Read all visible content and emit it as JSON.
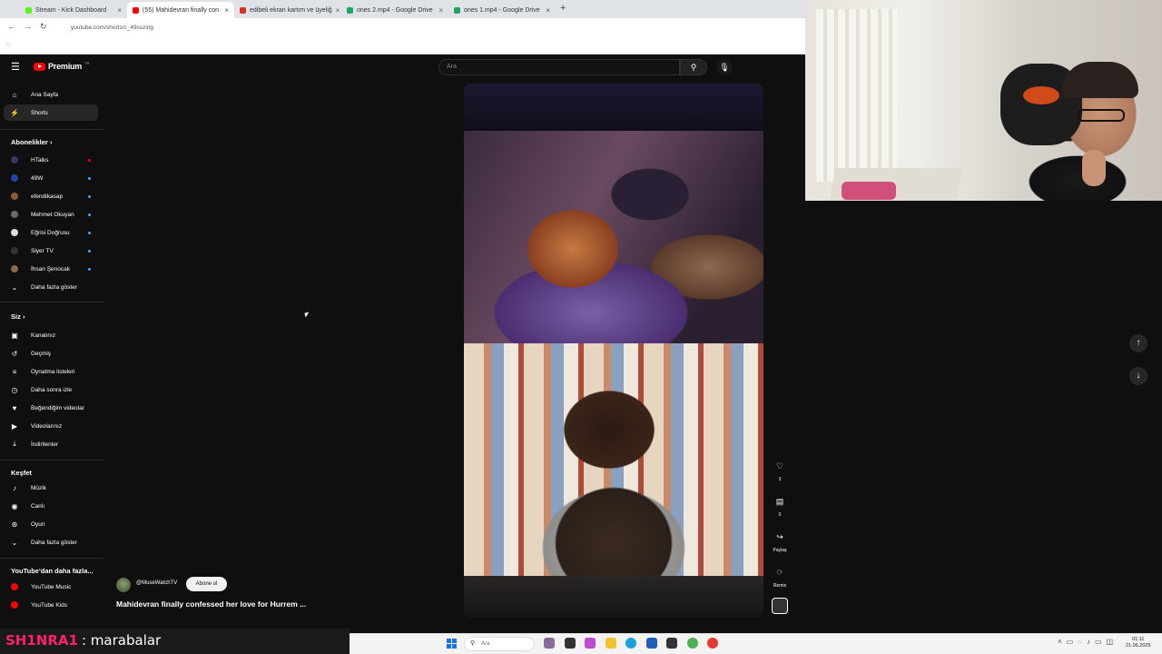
{
  "browser": {
    "tabs": [
      {
        "title": "Stream - Kick Dashboard",
        "favicon_color": "#53fc18",
        "active": false
      },
      {
        "title": "(55) Mahidevran finally con",
        "favicon_color": "#ff0000",
        "active": true
      },
      {
        "title": "edibeli ekran kartım ve üyeliğ",
        "favicon_color": "#d93025",
        "active": false
      },
      {
        "title": "ones 2.mp4 - Google Drive",
        "favicon_color": "#1fa463",
        "active": false
      },
      {
        "title": "ones 1.mp4 - Google Drive",
        "favicon_color": "#1fa463",
        "active": false
      }
    ],
    "url": "youtube.com/shorts/c_49sszing"
  },
  "youtube": {
    "logo_text": "Premium",
    "logo_suffix": "TR",
    "search_placeholder": "Ara",
    "sidebar": {
      "main": [
        {
          "label": "Ana Sayfa",
          "icon": "⌂",
          "name": "home"
        },
        {
          "label": "Shorts",
          "icon": "⚡",
          "name": "shorts",
          "selected": true
        }
      ],
      "subscriptions_header": "Abonelikler",
      "subscriptions": [
        {
          "label": "HTalks",
          "color": "#333a6a",
          "live": true
        },
        {
          "label": "49W",
          "color": "#2244aa"
        },
        {
          "label": "efendikasap",
          "color": "#8a5a3a"
        },
        {
          "label": "Mehmet Okuyan",
          "color": "#6a6a6a"
        },
        {
          "label": "Eğrisi Doğrusu",
          "color": "#dddddd"
        },
        {
          "label": "Siyer TV",
          "color": "#333333"
        },
        {
          "label": "İhsan Şenocak",
          "color": "#8a6a4a"
        }
      ],
      "show_more": "Daha fazla göster",
      "you_header": "Siz",
      "you": [
        {
          "label": "Kanalınız",
          "icon": "▣",
          "name": "your-channel"
        },
        {
          "label": "Geçmiş",
          "icon": "↺",
          "name": "history"
        },
        {
          "label": "Oynatma listeleri",
          "icon": "≡",
          "name": "playlists"
        },
        {
          "label": "Daha sonra izle",
          "icon": "◷",
          "name": "watch-later"
        },
        {
          "label": "Beğendiğim videolar",
          "icon": "👍",
          "name": "liked-videos"
        },
        {
          "label": "Videolarınız",
          "icon": "▶",
          "name": "your-videos"
        },
        {
          "label": "İndirilenler",
          "icon": "⤓",
          "name": "downloads"
        }
      ],
      "explore_header": "Keşfet",
      "explore": [
        {
          "label": "Müzik",
          "icon": "♪",
          "name": "music"
        },
        {
          "label": "Canlı",
          "icon": "◉",
          "name": "live"
        },
        {
          "label": "Oyun",
          "icon": "🎮",
          "name": "gaming"
        }
      ],
      "show_more_2": "Daha fazla göster",
      "more_header": "YouTube'dan daha fazla...",
      "more": [
        {
          "label": "YouTube Music",
          "color": "#ff0000"
        },
        {
          "label": "YouTube Kids",
          "color": "#ff0000"
        }
      ]
    },
    "short": {
      "channel": "@MuseWatchTV",
      "subscribe_label": "Abone ol",
      "title": "Mahidevran finally confessed her love for Hurrem ...",
      "actions": [
        {
          "name": "like",
          "icon": "♡",
          "label": "3"
        },
        {
          "name": "comments",
          "icon": "💬",
          "label": "0"
        },
        {
          "name": "share",
          "icon": "↪",
          "label": "Paylaş"
        },
        {
          "name": "remix",
          "icon": "⟳",
          "label": "Remix"
        }
      ]
    }
  },
  "stream_chat": {
    "user": "SH1NRA1",
    "message": ": marabalar"
  },
  "taskbar": {
    "search_placeholder": "Ara",
    "time": "01:11",
    "date": "21.06.2025"
  }
}
